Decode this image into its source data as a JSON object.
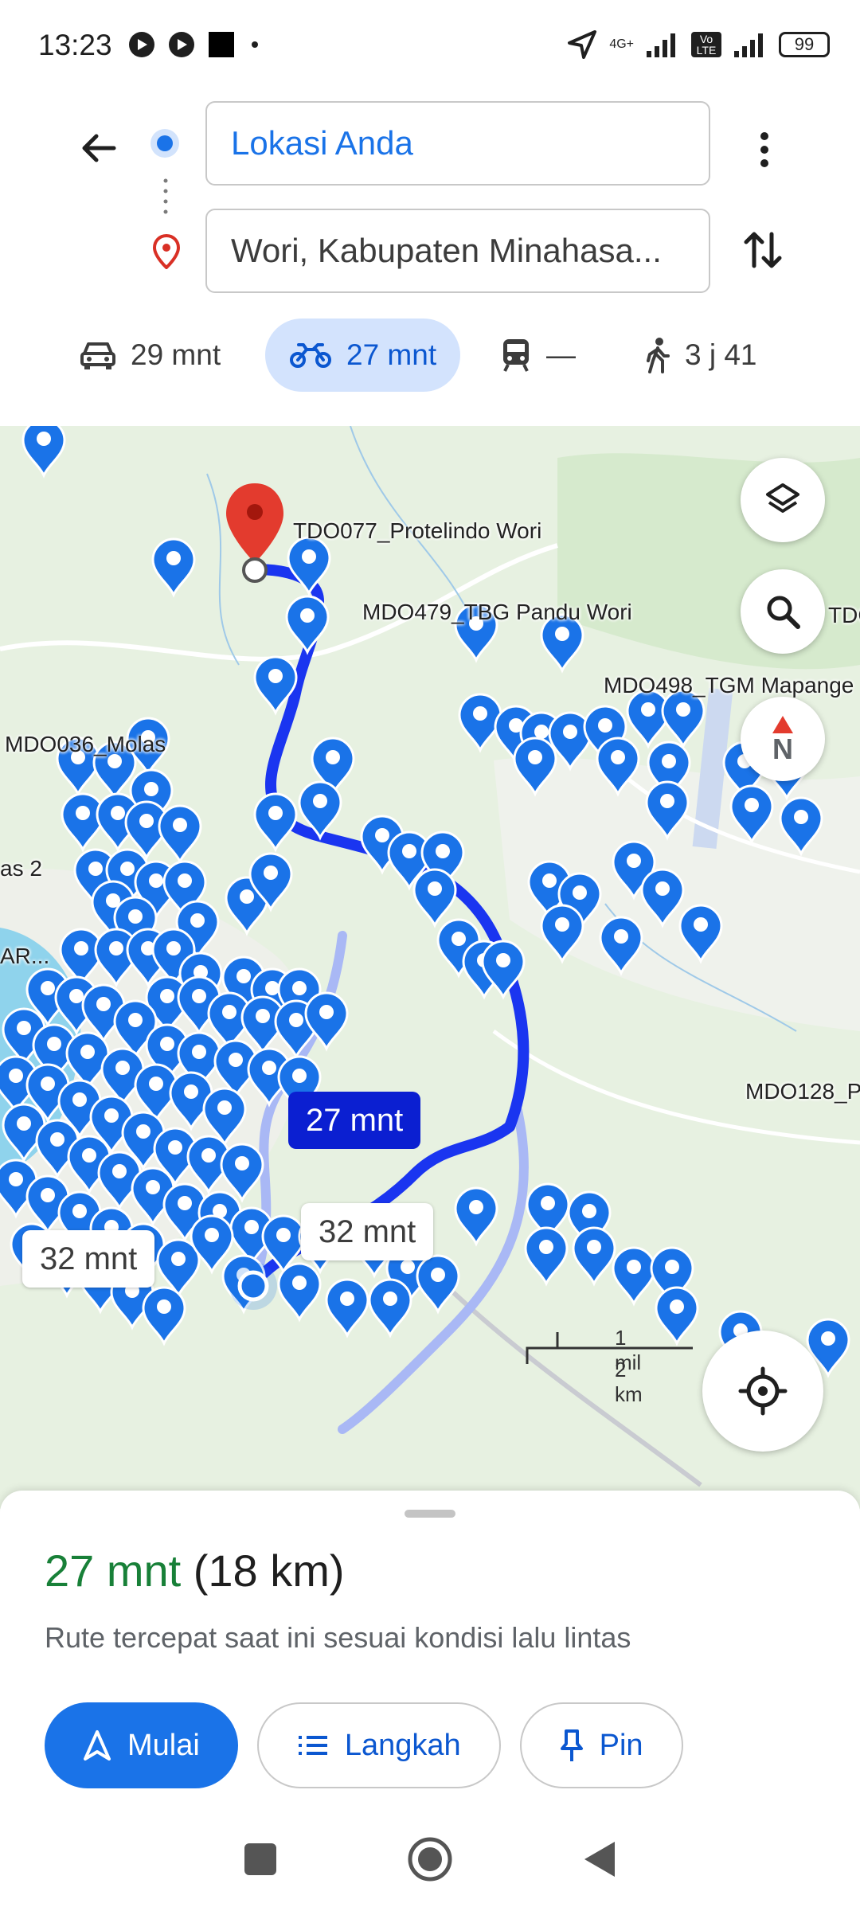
{
  "status_bar": {
    "time": "13:23",
    "network_label": "4G+",
    "volte_label": "Vo LTE",
    "battery": "99"
  },
  "search": {
    "origin": "Lokasi Anda",
    "destination": "Wori, Kabupaten Minahasa..."
  },
  "modes": [
    {
      "icon": "car-icon",
      "label": "29 mnt",
      "active": false
    },
    {
      "icon": "motorcycle-icon",
      "label": "27 mnt",
      "active": true
    },
    {
      "icon": "transit-icon",
      "label": "—",
      "active": false
    },
    {
      "icon": "walk-icon",
      "label": "3 j 41",
      "active": false
    }
  ],
  "map": {
    "labels": {
      "destination": "TDO077_Protelindo Wori",
      "pandu": "MDO479_TBG Pandu Wori",
      "tgm": "MDO498_TGM Mapange",
      "molas": "MDO036_Molas",
      "as2": "as 2",
      "ar": "AR...",
      "mdo128": "MDO128_P",
      "tdo_edge": "TDC"
    },
    "route_bubble_primary": "27 mnt",
    "route_bubble_alt_1": "32 mnt",
    "route_bubble_alt_2": "32 mnt",
    "scale_mi": "1 mil",
    "scale_km": "2 km",
    "compass_label": "N",
    "colors": {
      "route": "#1a35f0",
      "alt_route": "#a9b8f5",
      "pin": "#1a73e8",
      "dest_pin": "#e33b2e",
      "water": "#8fd3ec"
    }
  },
  "sheet": {
    "duration": "27 mnt",
    "distance": "(18 km)",
    "description": "Rute tercepat saat ini sesuai kondisi lalu lintas",
    "start_label": "Mulai",
    "steps_label": "Langkah",
    "pin_label": "Pin"
  }
}
